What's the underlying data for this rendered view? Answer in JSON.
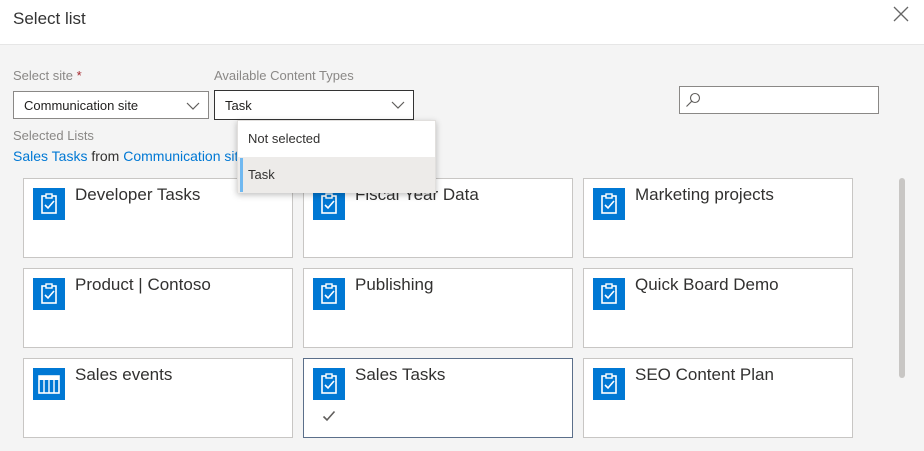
{
  "dialog": {
    "title": "Select list"
  },
  "site": {
    "label": "Select site",
    "required_mark": "*",
    "value": "Communication site"
  },
  "content_types": {
    "label": "Available Content Types",
    "value": "Task",
    "options": [
      {
        "label": "Not selected"
      },
      {
        "label": "Task"
      }
    ]
  },
  "search": {
    "placeholder": ""
  },
  "selected": {
    "label": "Selected Lists",
    "list_name": "Sales Tasks",
    "from_text": " from ",
    "site_name": "Communication site"
  },
  "lists": [
    {
      "name": "Developer Tasks",
      "icon": "task-list-icon",
      "selected": false
    },
    {
      "name": "Fiscal Year Data",
      "icon": "task-list-icon",
      "selected": false
    },
    {
      "name": "Marketing projects",
      "icon": "task-list-icon",
      "selected": false
    },
    {
      "name": "Product | Contoso",
      "icon": "task-list-icon",
      "selected": false
    },
    {
      "name": "Publishing",
      "icon": "task-list-icon",
      "selected": false
    },
    {
      "name": "Quick Board Demo",
      "icon": "task-list-icon",
      "selected": false
    },
    {
      "name": "Sales events",
      "icon": "calendar-list-icon",
      "selected": false
    },
    {
      "name": "Sales Tasks",
      "icon": "task-list-icon",
      "selected": true
    },
    {
      "name": "SEO Content Plan",
      "icon": "task-list-icon",
      "selected": false
    }
  ],
  "colors": {
    "accent": "#0078d4",
    "highlight_bar": "#70b8f0"
  }
}
